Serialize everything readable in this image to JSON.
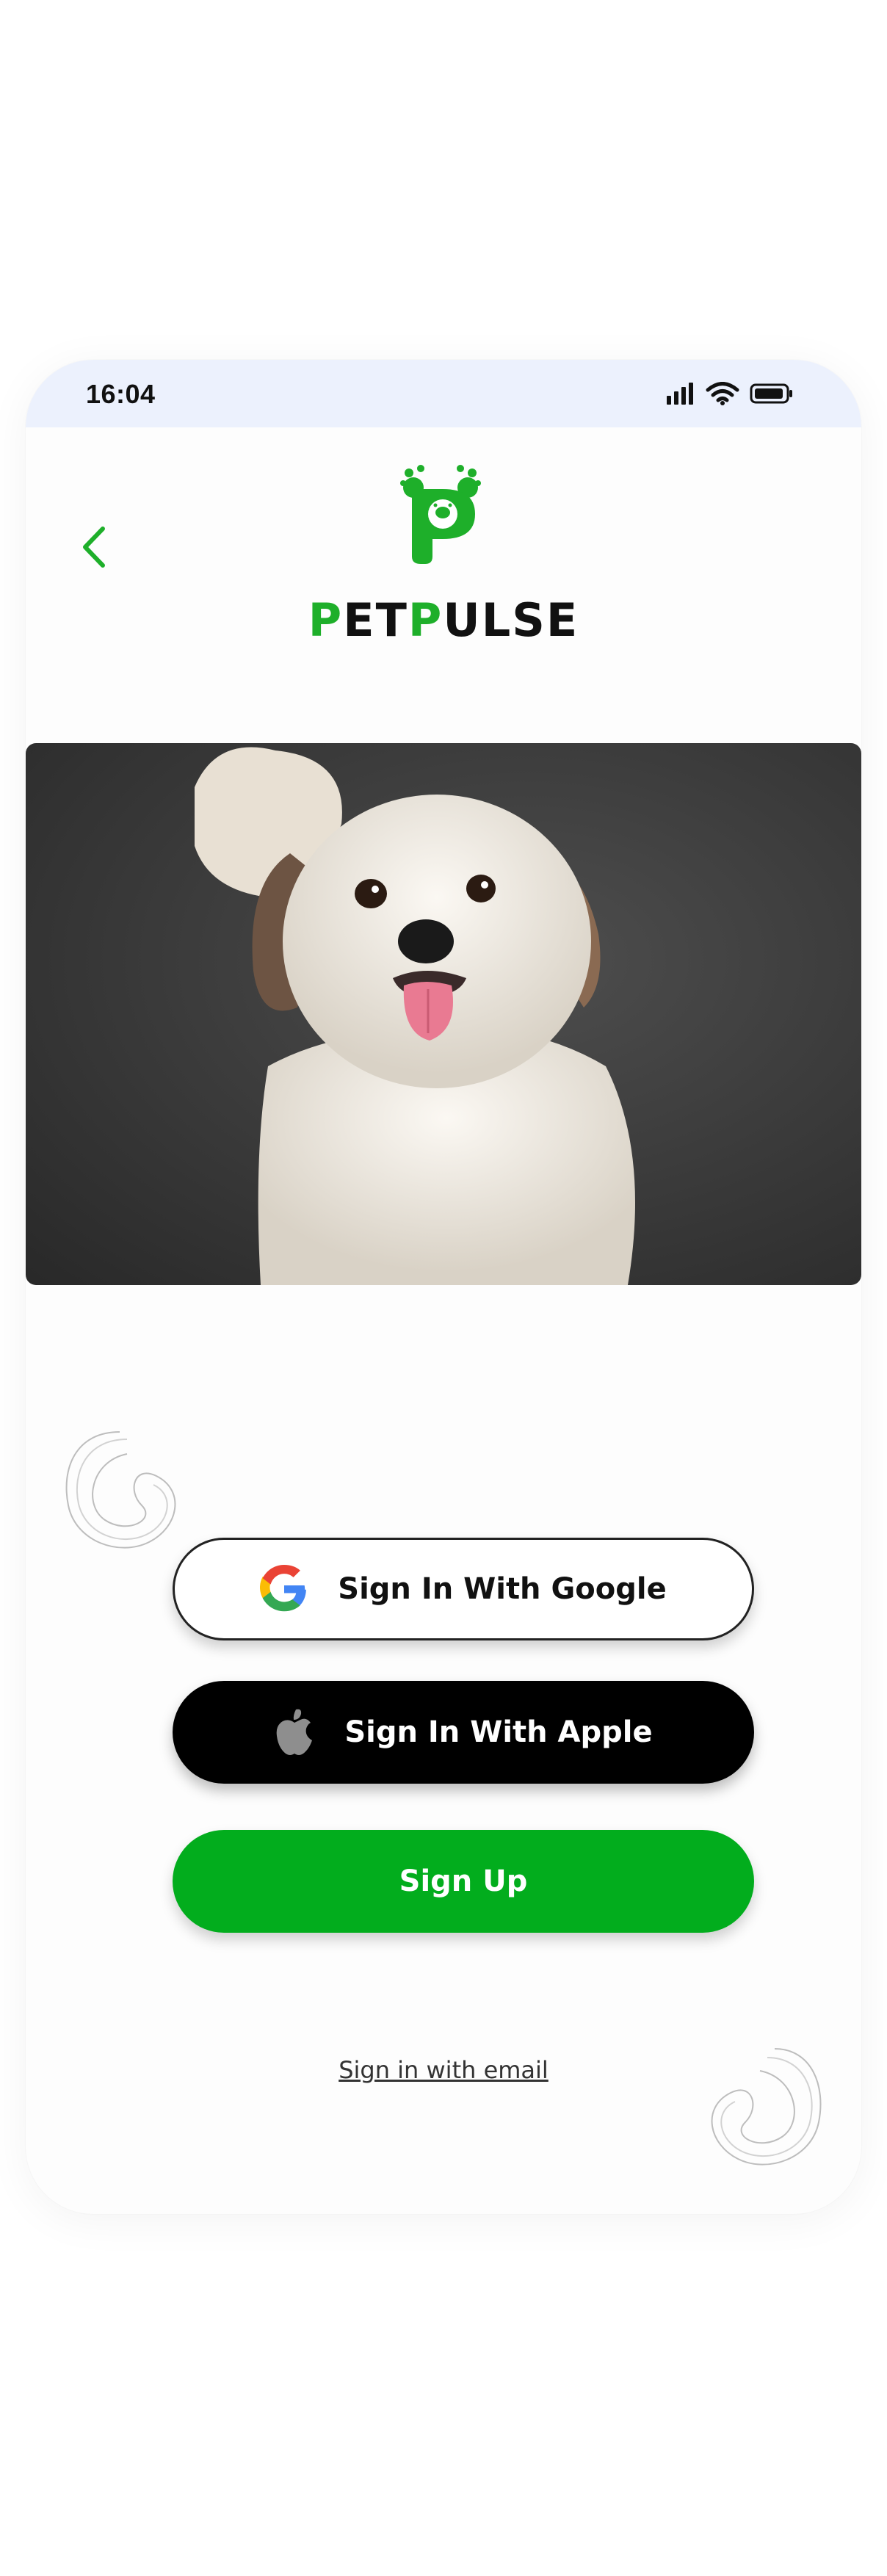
{
  "status_bar": {
    "time": "16:04",
    "icons": [
      "signal-icon",
      "wifi-icon",
      "battery-icon"
    ]
  },
  "header": {
    "back_icon": "chevron-left-icon",
    "brand_parts": [
      "P",
      "ET",
      "P",
      "ULSE"
    ],
    "brand_color": "#1eaf2a"
  },
  "hero": {
    "subject": "dog-photo"
  },
  "auth": {
    "google_label": "Sign In With Google",
    "apple_label": "Sign In With Apple",
    "signup_label": "Sign Up",
    "email_link": "Sign in with email"
  },
  "colors": {
    "accent": "#02ad1d",
    "status_bar_bg": "#ecf1fd",
    "apple_button_bg": "#000000"
  }
}
